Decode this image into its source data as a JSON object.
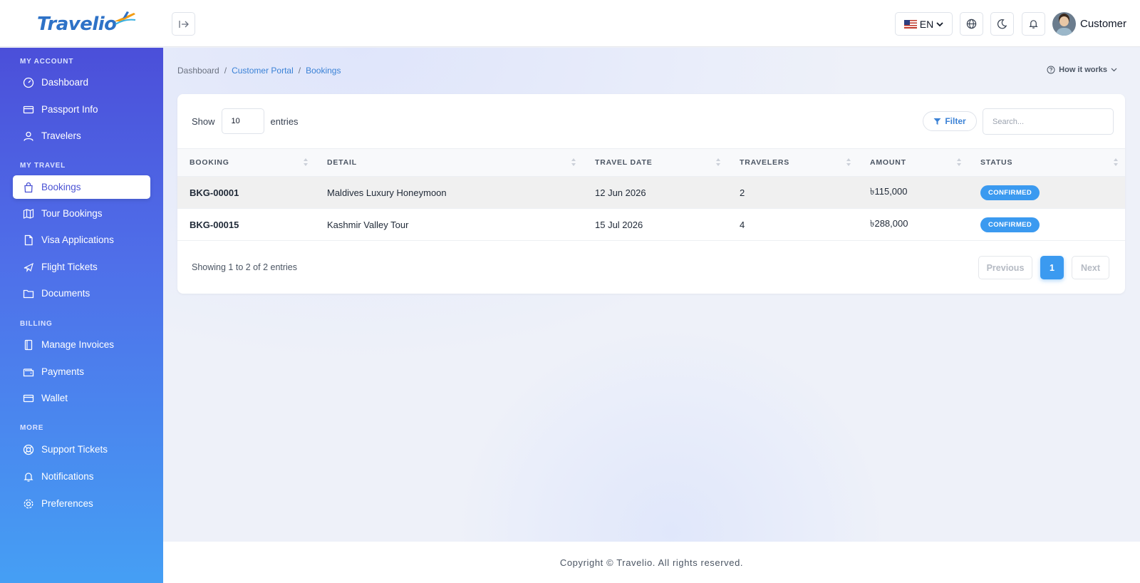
{
  "brand": {
    "name": "Travelio"
  },
  "header": {
    "language": "EN",
    "user_name": "Customer"
  },
  "sidebar": {
    "sections": [
      {
        "title": "MY ACCOUNT",
        "items": [
          "Dashboard",
          "Passport Info",
          "Travelers"
        ]
      },
      {
        "title": "MY TRAVEL",
        "items": [
          "Bookings",
          "Tour Bookings",
          "Visa Applications",
          "Flight Tickets",
          "Documents"
        ]
      },
      {
        "title": "BILLING",
        "items": [
          "Manage Invoices",
          "Payments",
          "Wallet"
        ]
      },
      {
        "title": "MORE",
        "items": [
          "Support Tickets",
          "Notifications",
          "Preferences"
        ]
      }
    ],
    "active_item": "Bookings"
  },
  "breadcrumb": [
    "Dashboard",
    "Customer Portal",
    "Bookings"
  ],
  "how_it_works": "How it works",
  "table_controls": {
    "show_label": "Show",
    "entries_value": "10",
    "entries_label": "entries",
    "filter_label": "Filter",
    "search_placeholder": "Search..."
  },
  "table": {
    "columns": [
      "BOOKING",
      "DETAIL",
      "TRAVEL DATE",
      "TRAVELERS",
      "AMOUNT",
      "STATUS"
    ],
    "rows": [
      {
        "booking": "BKG-00001",
        "detail": "Maldives Luxury Honeymoon",
        "date": "12 Jun 2026",
        "travelers": "2",
        "amount": "৳115,000",
        "status": "CONFIRMED"
      },
      {
        "booking": "BKG-00015",
        "detail": "Kashmir Valley Tour",
        "date": "15 Jul 2026",
        "travelers": "4",
        "amount": "৳288,000",
        "status": "CONFIRMED"
      }
    ]
  },
  "pagination": {
    "summary": "Showing 1 to 2 of 2 entries",
    "previous": "Previous",
    "current": "1",
    "next": "Next"
  },
  "footer": "Copyright © Travelio. All rights reserved.",
  "colors": {
    "accent": "#3b9af0",
    "sidebar_top": "#4b4fd9",
    "sidebar_bottom": "#459ff4",
    "link": "#3b82d6"
  }
}
